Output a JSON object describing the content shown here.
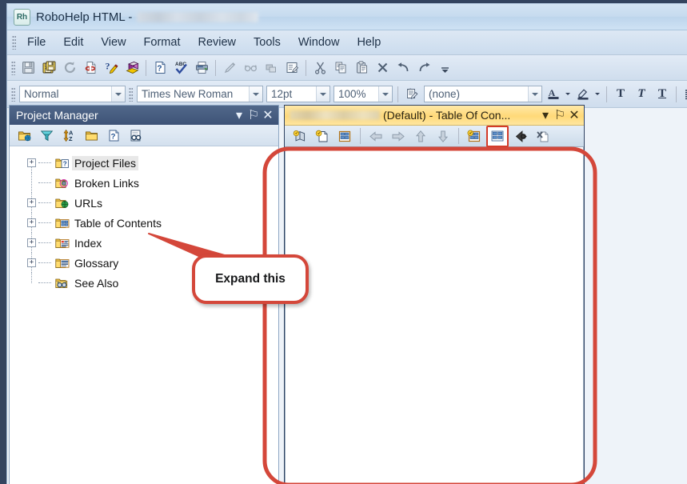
{
  "window": {
    "app_badge": "Rh",
    "title": "RoboHelp HTML -",
    "title_redacted": true
  },
  "menubar": {
    "items": [
      "File",
      "Edit",
      "View",
      "Format",
      "Review",
      "Tools",
      "Window",
      "Help"
    ]
  },
  "toolbar_standard": {
    "buttons": [
      {
        "name": "save-icon",
        "label": "Save"
      },
      {
        "name": "save-all-icon",
        "label": "Save All"
      },
      {
        "name": "refresh-icon",
        "label": "Refresh"
      },
      {
        "name": "broken-link-icon",
        "label": "Check Links"
      },
      {
        "name": "marker-icon",
        "label": "Topic Properties"
      },
      {
        "name": "book-icon",
        "label": "Generate"
      },
      {
        "name": "help-topic-icon",
        "label": "Topic Help"
      },
      {
        "name": "spellcheck-icon",
        "label": "Spell Check"
      },
      {
        "name": "print-icon",
        "label": "Print"
      },
      {
        "name": "pencil-icon",
        "label": "Edit"
      },
      {
        "name": "glasses-icon",
        "label": "View"
      },
      {
        "name": "copy-topic-icon",
        "label": "Duplicate"
      },
      {
        "name": "properties-icon",
        "label": "Properties"
      },
      {
        "name": "cut-icon",
        "label": "Cut"
      },
      {
        "name": "copy-icon",
        "label": "Copy"
      },
      {
        "name": "paste-icon",
        "label": "Paste"
      },
      {
        "name": "delete-icon",
        "label": "Delete"
      },
      {
        "name": "undo-icon",
        "label": "Undo"
      },
      {
        "name": "redo-icon",
        "label": "Redo"
      },
      {
        "name": "overflow-icon",
        "label": "More"
      }
    ]
  },
  "toolbar_format": {
    "style": {
      "value": "Normal"
    },
    "font": {
      "value": "Times New Roman"
    },
    "size": {
      "value": "12pt"
    },
    "zoom": {
      "value": "100%"
    },
    "style_sheet_icon": "stylesheet-icon",
    "stylesheet": {
      "value": "(none)"
    },
    "font_color_icon": "font-color-icon",
    "highlight_icon": "highlight-icon",
    "bold_label": "T",
    "italic_label": "T",
    "underline_label": "T",
    "align_icon": "align-icon"
  },
  "project_manager": {
    "caption": "Project Manager",
    "caption_buttons": [
      {
        "name": "panel-menu-button",
        "glyph": "▾"
      },
      {
        "name": "panel-pin-button",
        "glyph": "⚐"
      },
      {
        "name": "panel-close-button",
        "glyph": "✕"
      }
    ],
    "toolbar": [
      {
        "name": "new-folder-web-icon",
        "label": "New"
      },
      {
        "name": "filter-icon",
        "label": "Filter"
      },
      {
        "name": "sort-az-icon",
        "label": "Sort"
      },
      {
        "name": "folder-icon",
        "label": "Folder"
      },
      {
        "name": "topic-properties-icon",
        "label": "Properties"
      },
      {
        "name": "find-icon",
        "label": "Find"
      }
    ],
    "tree": [
      {
        "label": "Project Files",
        "icon": "folder-topic-icon",
        "expandable": true,
        "selected": true
      },
      {
        "label": "Broken Links",
        "icon": "folder-broken-link-icon",
        "expandable": false,
        "selected": false
      },
      {
        "label": "URLs",
        "icon": "folder-url-icon",
        "expandable": true,
        "selected": false
      },
      {
        "label": "Table of Contents",
        "icon": "folder-toc-icon",
        "expandable": true,
        "selected": false
      },
      {
        "label": "Index",
        "icon": "folder-index-icon",
        "expandable": true,
        "selected": false
      },
      {
        "label": "Glossary",
        "icon": "folder-glossary-icon",
        "expandable": true,
        "selected": false
      },
      {
        "label": "See Also",
        "icon": "folder-see-also-icon",
        "expandable": false,
        "selected": false
      }
    ]
  },
  "toc_window": {
    "title": "(Default) - Table Of Con...",
    "title_redacted": true,
    "caption_buttons": [
      {
        "name": "doc-menu-button",
        "glyph": "▾"
      },
      {
        "name": "doc-pin-button",
        "glyph": "⚐"
      },
      {
        "name": "doc-close-button",
        "glyph": "✕"
      }
    ],
    "toolbar": [
      {
        "name": "new-book-icon",
        "label": "New Book"
      },
      {
        "name": "new-page-icon",
        "label": "New Page"
      },
      {
        "name": "properties-icon",
        "label": "Properties"
      },
      {
        "name": "move-left-icon",
        "label": "Move Left"
      },
      {
        "name": "move-right-icon",
        "label": "Move Right"
      },
      {
        "name": "move-up-icon",
        "label": "Move Up"
      },
      {
        "name": "move-down-icon",
        "label": "Move Down"
      },
      {
        "name": "auto-create-toc-icon",
        "label": "Auto-create TOC"
      },
      {
        "name": "toc-view-icon",
        "label": "TOC View",
        "active": true
      },
      {
        "name": "link-topic-icon",
        "label": "Link"
      },
      {
        "name": "remove-icon",
        "label": "Remove"
      }
    ],
    "content": ""
  },
  "annotation": {
    "callout_text": "Expand this",
    "callout_color": "#d4473a",
    "highlight_rect_color": "#d4473a",
    "pointer_target": "Table of Contents"
  },
  "colors": {
    "desktop": "#34445f",
    "chrome": "#cfdded",
    "panel_caption": "#3e5377",
    "doc_caption": "#ffd978",
    "annotation": "#d4473a"
  }
}
